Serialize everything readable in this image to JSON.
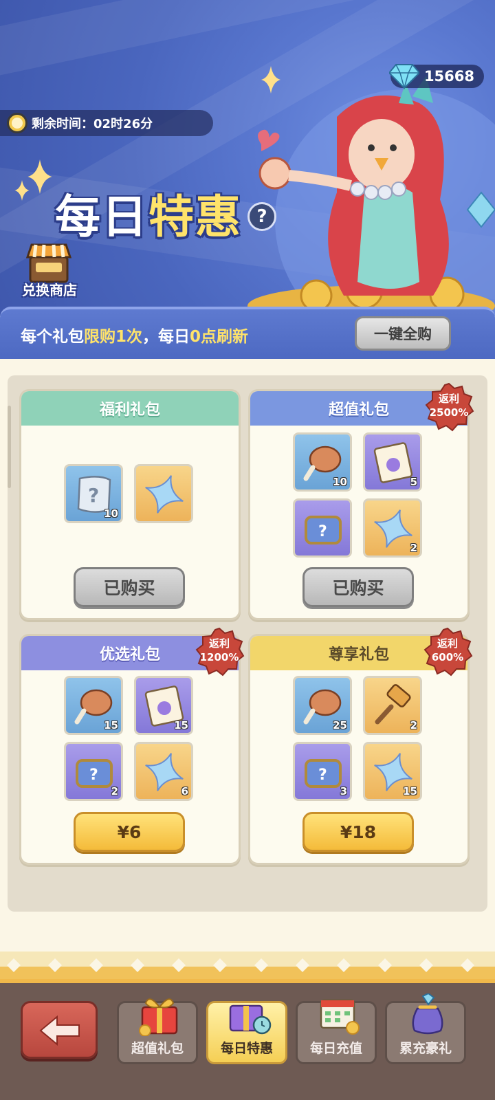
{
  "header": {
    "diamonds": "15668",
    "timer_label": "剩余时间：02时26分",
    "title_part1": "每日",
    "title_part2": "特惠",
    "help": "?",
    "shop_label": "兑换商店"
  },
  "notice": {
    "p1": "每个礼包",
    "p2": "限购1次",
    "p3": "，每日",
    "p4": "0点刷新",
    "buy_all_label": "一键全购"
  },
  "packs": [
    {
      "title": "福利礼包",
      "items": [
        {
          "icon": "scroll-icon",
          "qty": "10"
        },
        {
          "icon": "star-crystal-icon",
          "qty": ""
        }
      ],
      "button": "已购买",
      "purchased": true
    },
    {
      "title": "超值礼包",
      "badge": [
        "返利",
        "2500%"
      ],
      "items": [
        {
          "icon": "meat-icon",
          "qty": "10"
        },
        {
          "icon": "integral-ticket-icon",
          "qty": "5"
        },
        {
          "icon": "mystery-chest-icon",
          "qty": ""
        },
        {
          "icon": "star-crystal-icon",
          "qty": "2"
        }
      ],
      "button": "已购买",
      "purchased": true
    },
    {
      "title": "优选礼包",
      "badge": [
        "返利",
        "1200%"
      ],
      "items": [
        {
          "icon": "meat-icon",
          "qty": "15"
        },
        {
          "icon": "integral-ticket-icon",
          "qty": "15"
        },
        {
          "icon": "mystery-chest-icon",
          "qty": "2"
        },
        {
          "icon": "star-crystal-icon",
          "qty": "6"
        }
      ],
      "button": "¥6",
      "purchased": false
    },
    {
      "title": "尊享礼包",
      "badge": [
        "返利",
        "600%"
      ],
      "items": [
        {
          "icon": "meat-icon",
          "qty": "25"
        },
        {
          "icon": "hammer-icon",
          "qty": "2"
        },
        {
          "icon": "mystery-chest-icon",
          "qty": "3"
        },
        {
          "icon": "star-crystal-icon",
          "qty": "15"
        }
      ],
      "button": "¥18",
      "purchased": false
    }
  ],
  "nav": {
    "back": "back-arrow-icon",
    "tabs": [
      {
        "label": "超值礼包",
        "icon": "gift-box-icon",
        "active": false
      },
      {
        "label": "每日特惠",
        "icon": "timed-gift-icon",
        "active": true
      },
      {
        "label": "每日充值",
        "icon": "calendar-coins-icon",
        "active": false
      },
      {
        "label": "累充豪礼",
        "icon": "treasure-bag-icon",
        "active": false
      }
    ]
  },
  "colors": {
    "hero_blue": "#4a66be",
    "accent_yellow": "#ffe36a",
    "badge_red": "#c8473a",
    "price_gold": "#f4bb3a"
  }
}
